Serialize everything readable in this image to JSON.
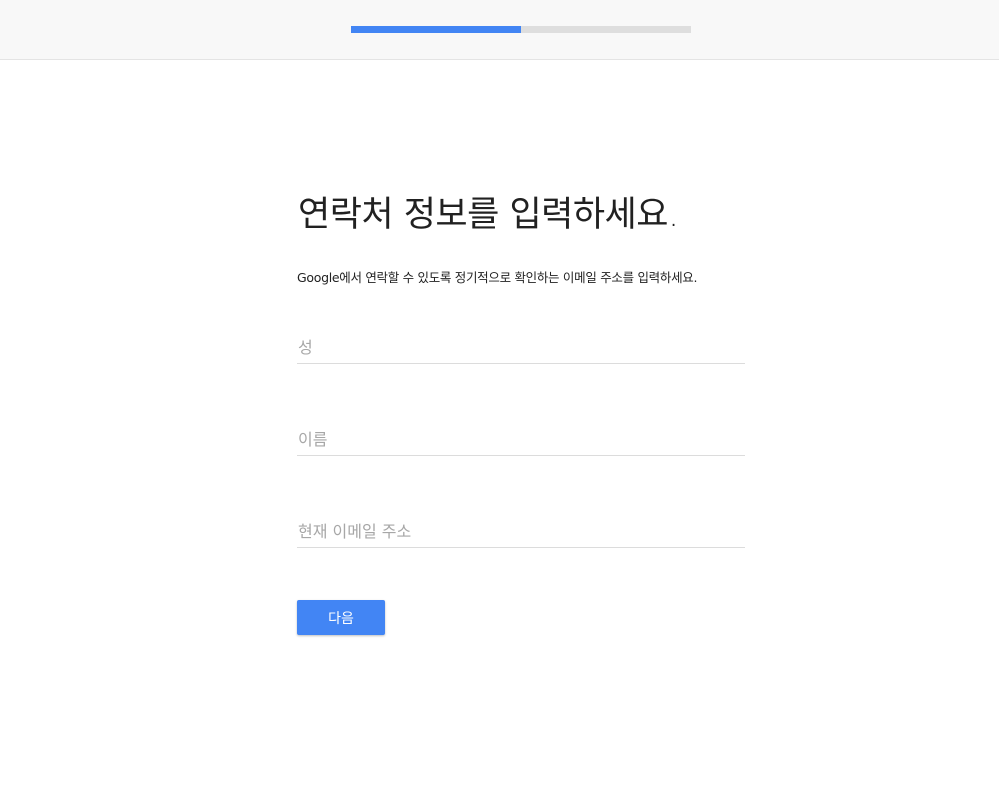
{
  "progress": {
    "value_fraction": 0.5,
    "fill_color": "#4285f4",
    "track_color": "#dedede"
  },
  "page": {
    "title": "연락처 정보를 입력하세요.",
    "subtitle": "Google에서 연락할 수 있도록 정기적으로 확인하는 이메일 주소를 입력하세요."
  },
  "form": {
    "last_name": {
      "placeholder": "성",
      "value": ""
    },
    "first_name": {
      "placeholder": "이름",
      "value": ""
    },
    "email": {
      "placeholder": "현재 이메일 주소",
      "value": ""
    }
  },
  "buttons": {
    "next_label": "다음"
  }
}
